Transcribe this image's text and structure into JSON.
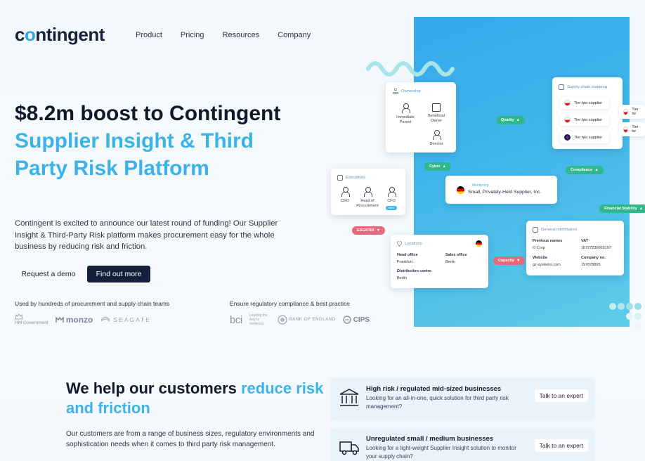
{
  "header": {
    "logo_prefix": "c",
    "logo_o": "o",
    "logo_suffix": "ntingent",
    "nav": [
      "Product",
      "Pricing",
      "Resources",
      "Company"
    ]
  },
  "hero": {
    "title_part1": "$8.2m boost to Contingent ",
    "title_highlight": "Supplier Insight & Third Party Risk Platform",
    "description": "Contingent is excited to announce our latest round of funding! Our Supplier Insight & Third-Party Risk platform makes procurement easy for the whole business by reducing risk and friction.",
    "btn_demo": "Request a demo",
    "btn_find": "Find out more",
    "used_label": "Used by hundreds of procurement and supply chain teams",
    "ensure_label": "Ensure regulatory compliance & best practice",
    "logos_left": [
      "HM Government",
      "monzo",
      "SEAGATE"
    ],
    "logos_right": [
      "bci",
      "Leading the way to resilience",
      "BANK OF ENGLAND",
      "CIPS"
    ]
  },
  "visual": {
    "ownership": {
      "title": "Ownership",
      "nodes": [
        "Immediate Parent",
        "Beneficial Owner",
        "Director"
      ]
    },
    "executives": {
      "title": "Executives",
      "nodes": [
        "CEO",
        "Head of Procurement",
        "CFO"
      ],
      "badge": "New"
    },
    "supply_chain": {
      "title": "Supply chain mapping",
      "tiers": [
        "Tier two supplier",
        "Tier two supplier",
        "Tier two supplier"
      ],
      "tiers_right": [
        "Tier tw",
        "Tier tw"
      ]
    },
    "monitoring": {
      "label": "Monitoring",
      "company": "Small, Privately-Held Supplier, Inc."
    },
    "locations": {
      "title": "Locations",
      "head_office_label": "Head office",
      "head_office": "Frankfurt",
      "sales_office_label": "Sales office",
      "sales_office": "Berlin",
      "distribution_label": "Distribution centre",
      "distribution": "Berlin"
    },
    "general": {
      "title": "General information",
      "prev_names_label": "Previous names",
      "prev_names": "O Corp",
      "vat_label": "VAT",
      "vat": "16727230000197",
      "website_label": "Website",
      "website": "gz-systems.com",
      "company_no_label": "Company no.",
      "company_no": "197878895"
    },
    "pills": {
      "quality": "Quality",
      "cyber": "Cyber",
      "compliance": "Compliance",
      "financial": "Financial Stability",
      "esg": "ESG/CSR",
      "capacity": "Capacity"
    },
    "colors": {
      "panel": "#3fb4ea",
      "green": "#2fb98a",
      "red": "#e46a7a"
    }
  },
  "section2": {
    "title_part1": "We help our customers ",
    "title_highlight": "reduce risk and friction",
    "description": "Our customers are from a range of business sizes, regulatory environments and sophistication needs when it comes to third party risk management.",
    "cards": [
      {
        "icon": "bank-icon",
        "title": "High risk / regulated mid-sized businesses",
        "desc": "Looking for an all-in-one, quick solution for third party risk management?",
        "button": "Talk to an expert"
      },
      {
        "icon": "truck-icon",
        "title": "Unregulated small / medium businesses",
        "desc": "Looking for a light-weight Supplier Insight solution to monitor your supply chain?",
        "button": "Talk to an expert"
      }
    ]
  }
}
